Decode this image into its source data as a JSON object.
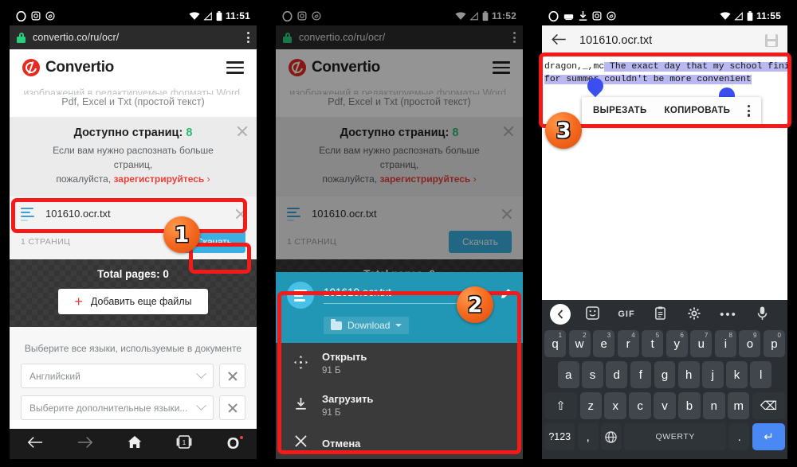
{
  "panels": [
    {
      "statusbar": {
        "time": "11:51",
        "icons": [
          "opera-icon",
          "screenshot-icon",
          "shazam-icon"
        ],
        "right_icons": [
          "wifi-icon",
          "signal-icon",
          "battery-icon"
        ]
      },
      "browser": {
        "url": "convertio.co/ru/ocr/",
        "lock": "lock-icon",
        "menu": "kebab-menu-icon"
      },
      "site": {
        "brand": "Convertio",
        "tagline_cut": "изображений в редактируемые форматы Word,",
        "tagline": "Pdf, Excel и Txt (простой текст)",
        "notice": {
          "title": "Доступно страниц:",
          "count": "8",
          "text": "Если вам нужно распознать больше страниц,",
          "text2": "пожалуйста,",
          "link": "зарегистрируйтесь",
          "arrow": "›"
        },
        "file": {
          "name": "101610.ocr.txt",
          "pages": "1 СТРАНИЦ",
          "download": "Скачать"
        },
        "total": {
          "label": "Total pages: 0",
          "add_button": "Добавить еще файлы"
        },
        "langs": {
          "hint": "Выберите все языки, используемые в документе",
          "primary": "Английский",
          "secondary": "Выберите дополнительные языки..."
        }
      },
      "opera_nav": [
        "back-arrow-icon",
        "forward-arrow-icon",
        "home-icon",
        "tabs-icon",
        "opera-menu-icon"
      ],
      "tab_count": "1"
    },
    {
      "statusbar": {
        "time": "11:52"
      },
      "browser": {
        "url": "convertio.co/ru/ocr/"
      },
      "sheet": {
        "filename": "101610.ocr.txt",
        "folder": "Download",
        "edit_icon": "pencil-icon",
        "items": [
          {
            "label": "Открыть",
            "size": "91 Б",
            "icon": "open-move-icon"
          },
          {
            "label": "Загрузить",
            "size": "91 Б",
            "icon": "download-icon"
          },
          {
            "label": "Отмена",
            "size": "",
            "icon": "close-icon"
          }
        ]
      }
    },
    {
      "statusbar": {
        "time": "11:55",
        "icons": [
          "opera-icon",
          "keyboard-icon",
          "download-icon",
          "screenshot-icon",
          "shazam-icon"
        ]
      },
      "appbar": {
        "title": "101610.ocr.txt",
        "back": "back-arrow-icon",
        "save": "save-icon"
      },
      "editor": {
        "line1_pre": "dragon,_,mc",
        "line1_sel": " The exact day that my school finishes",
        "line2_sel": "for summer couldn't be more convenient"
      },
      "context_menu": {
        "cut": "ВЫРЕЗАТЬ",
        "copy": "КОПИРОВАТЬ",
        "more": "kebab-menu-icon"
      },
      "keyboard": {
        "toolbar": [
          "back-chevron-icon",
          "sticker-icon",
          "GIF",
          "clipboard-icon",
          "settings-gear-icon",
          "more-dots-icon",
          "microphone-icon"
        ],
        "row1": [
          {
            "k": "q",
            "n": "1"
          },
          {
            "k": "w",
            "n": "2"
          },
          {
            "k": "e",
            "n": "3"
          },
          {
            "k": "r",
            "n": "4"
          },
          {
            "k": "t",
            "n": "5"
          },
          {
            "k": "y",
            "n": "6"
          },
          {
            "k": "u",
            "n": "7"
          },
          {
            "k": "i",
            "n": "8"
          },
          {
            "k": "o",
            "n": "9"
          },
          {
            "k": "p",
            "n": "0"
          }
        ],
        "row2": [
          "a",
          "s",
          "d",
          "f",
          "g",
          "h",
          "j",
          "k",
          "l"
        ],
        "row3": [
          "⇧",
          "z",
          "x",
          "c",
          "v",
          "b",
          "n",
          "m",
          "⌫"
        ],
        "row4": {
          "num": "?123",
          "comma": ",",
          "globe": "globe-icon",
          "space": "QWERTY",
          "period": ".",
          "enter": "↵"
        }
      }
    }
  ],
  "annotations": {
    "badge1": "1",
    "badge2": "2",
    "badge3": "3",
    "color": "#f41a19"
  }
}
